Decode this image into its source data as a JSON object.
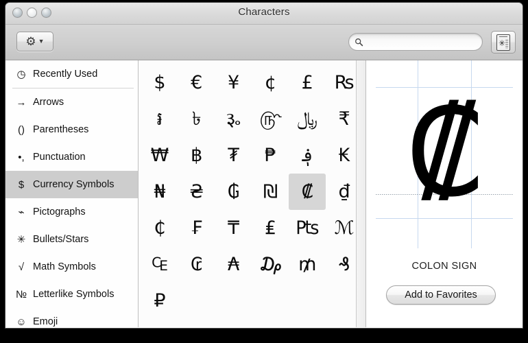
{
  "window": {
    "title": "Characters",
    "traffic_lights": [
      {
        "name": "close",
        "label": "Close"
      },
      {
        "name": "minimize",
        "label": "Minimize"
      },
      {
        "name": "zoom",
        "label": "Zoom"
      }
    ]
  },
  "toolbar": {
    "gear_icon": "gear-icon",
    "gear_caret": "▼",
    "gear_label": "⚙",
    "caret_label": "▼",
    "search": {
      "icon": "search-icon",
      "value": "",
      "placeholder": ""
    },
    "palette_button": {
      "icon": "character-palette-icon",
      "star": "✳"
    }
  },
  "sidebar": {
    "items": [
      {
        "icon": "clock-icon",
        "glyph": "◷",
        "label": "Recently Used",
        "selected": false
      },
      {
        "icon": "arrow-icon",
        "glyph": "→",
        "label": "Arrows",
        "selected": false
      },
      {
        "icon": "parentheses-icon",
        "glyph": "()",
        "label": "Parentheses",
        "selected": false
      },
      {
        "icon": "punctuation-icon",
        "glyph": "•,",
        "label": "Punctuation",
        "selected": false
      },
      {
        "icon": "dollar-icon",
        "glyph": "$",
        "label": "Currency Symbols",
        "selected": true
      },
      {
        "icon": "pictograph-icon",
        "glyph": "⌁",
        "label": "Pictographs",
        "selected": false
      },
      {
        "icon": "asterisk-icon",
        "glyph": "✳",
        "label": "Bullets/Stars",
        "selected": false
      },
      {
        "icon": "radical-icon",
        "glyph": "√",
        "label": "Math Symbols",
        "selected": false
      },
      {
        "icon": "numero-icon",
        "glyph": "№",
        "label": "Letterlike Symbols",
        "selected": false
      },
      {
        "icon": "smiley-icon",
        "glyph": "☺",
        "label": "Emoji",
        "selected": false
      }
    ],
    "separator_after_index": 0
  },
  "grid": {
    "characters": [
      {
        "glyph": "$",
        "name": "DOLLAR SIGN",
        "selected": false
      },
      {
        "glyph": "€",
        "name": "EURO SIGN",
        "selected": false
      },
      {
        "glyph": "¥",
        "name": "YEN SIGN",
        "selected": false
      },
      {
        "glyph": "¢",
        "name": "CENT SIGN",
        "selected": false
      },
      {
        "glyph": "£",
        "name": "POUND SIGN",
        "selected": false
      },
      {
        "glyph": "₨",
        "name": "RUPEE SIGN",
        "selected": false
      },
      {
        "glyph": "៛",
        "name": "KHMER CURRENCY SYMBOL RIEL",
        "selected": false
      },
      {
        "glyph": "৳",
        "name": "BENGALI RUPEE SIGN",
        "selected": false
      },
      {
        "glyph": "૱",
        "name": "GUJARATI RUPEE SIGN",
        "selected": false
      },
      {
        "glyph": "௹",
        "name": "TAMIL RUPEE SIGN",
        "selected": false
      },
      {
        "glyph": "﷼",
        "name": "RIAL SIGN",
        "selected": false
      },
      {
        "glyph": "₹",
        "name": "INDIAN RUPEE SIGN",
        "selected": false
      },
      {
        "glyph": "₩",
        "name": "WON SIGN",
        "selected": false
      },
      {
        "glyph": "฿",
        "name": "BAHT SIGN",
        "selected": false
      },
      {
        "glyph": "₮",
        "name": "TUGRIK SIGN",
        "selected": false
      },
      {
        "glyph": "₱",
        "name": "PESO SIGN",
        "selected": false
      },
      {
        "glyph": "؋",
        "name": "AFGHANI SIGN",
        "selected": false
      },
      {
        "glyph": "₭",
        "name": "KIP SIGN",
        "selected": false
      },
      {
        "glyph": "₦",
        "name": "NAIRA SIGN",
        "selected": false
      },
      {
        "glyph": "₴",
        "name": "HRYVNIA SIGN",
        "selected": false
      },
      {
        "glyph": "₲",
        "name": "GUARANI SIGN",
        "selected": false
      },
      {
        "glyph": "₪",
        "name": "NEW SHEQEL SIGN",
        "selected": false
      },
      {
        "glyph": "₡",
        "name": "COLON SIGN",
        "selected": true
      },
      {
        "glyph": "₫",
        "name": "DONG SIGN",
        "selected": false
      },
      {
        "glyph": "₵",
        "name": "CEDI SIGN",
        "selected": false
      },
      {
        "glyph": "₣",
        "name": "FRENCH FRANC SIGN",
        "selected": false
      },
      {
        "glyph": "₸",
        "name": "TENGE SIGN",
        "selected": false
      },
      {
        "glyph": "₤",
        "name": "LIRA SIGN",
        "selected": false
      },
      {
        "glyph": "₧",
        "name": "PESETA SIGN",
        "selected": false
      },
      {
        "glyph": "ℳ",
        "name": "MARK SIGN",
        "selected": false
      },
      {
        "glyph": "₠",
        "name": "EURO-CURRENCY SIGN",
        "selected": false
      },
      {
        "glyph": "₢",
        "name": "CRUZEIRO SIGN",
        "selected": false
      },
      {
        "glyph": "₳",
        "name": "AUSTRAL SIGN",
        "selected": false
      },
      {
        "glyph": "₯",
        "name": "DRACHMA SIGN",
        "selected": false
      },
      {
        "glyph": "₥",
        "name": "MILL SIGN",
        "selected": false
      },
      {
        "glyph": "₰",
        "name": "GERMAN PENNY SIGN",
        "selected": false
      },
      {
        "glyph": "₽",
        "name": "RUBLE SIGN",
        "selected": false
      }
    ]
  },
  "preview": {
    "glyph": "₡",
    "character_name": "COLON SIGN",
    "favorites_button_label": "Add to Favorites"
  },
  "colors": {
    "window_frame": "#000000",
    "titlebar_top": "#e9e9e9",
    "toolbar_top": "#d7d7d7",
    "sidebar_selection": "#cdcdcd",
    "cell_selection": "#d6d6d6",
    "guide_line": "#c6d8ef",
    "text": "#121212"
  }
}
